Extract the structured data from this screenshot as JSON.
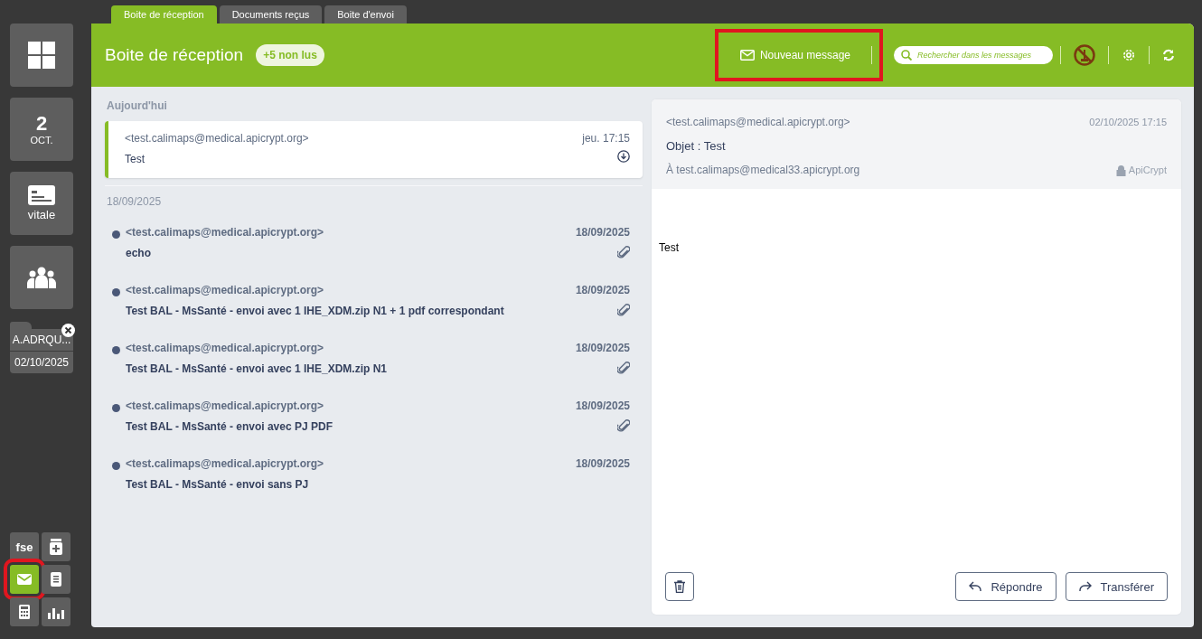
{
  "sidebar": {
    "tiles": [
      {
        "kind": "apps"
      },
      {
        "kind": "date",
        "day": "2",
        "month": "OCT."
      },
      {
        "kind": "card",
        "label": "vitale"
      },
      {
        "kind": "group"
      }
    ],
    "patient_folder": {
      "name": "A.ADRQU...",
      "date": "02/10/2025"
    },
    "shortcuts": [
      {
        "kind": "fse",
        "label": "fse",
        "selected": false,
        "highlighted": false
      },
      {
        "kind": "medicine",
        "selected": false,
        "highlighted": false
      },
      {
        "kind": "mail",
        "selected": true,
        "highlighted": true
      },
      {
        "kind": "document",
        "selected": false,
        "highlighted": false
      },
      {
        "kind": "calculator",
        "selected": false,
        "highlighted": false
      },
      {
        "kind": "chart",
        "selected": false,
        "highlighted": false
      }
    ]
  },
  "tabs": [
    {
      "label": "Boite de réception",
      "selected": true
    },
    {
      "label": "Documents reçus",
      "selected": false
    },
    {
      "label": "Boite d'envoi",
      "selected": false
    }
  ],
  "header": {
    "title": "Boite de réception",
    "unread_badge": "+5 non lus",
    "new_message": {
      "label": "Nouveau message",
      "highlighted": true
    },
    "search": {
      "placeholder": "Rechercher dans les messages"
    }
  },
  "message_groups": [
    {
      "heading": "Aujourd'hui",
      "messages": [
        {
          "sender": "<test.calimaps@medical.apicrypt.org>",
          "subject": "Test",
          "time": "jeu. 17:15",
          "unread": false,
          "selected": true,
          "attachment": false,
          "downloadable": true
        }
      ]
    },
    {
      "heading": "18/09/2025",
      "messages": [
        {
          "sender": "<test.calimaps@medical.apicrypt.org>",
          "subject": "echo",
          "time": "18/09/2025",
          "unread": true,
          "selected": false,
          "attachment": true,
          "downloadable": false
        },
        {
          "sender": "<test.calimaps@medical.apicrypt.org>",
          "subject": "Test BAL - MsSanté - envoi avec 1 IHE_XDM.zip N1 + 1 pdf correspondant",
          "time": "18/09/2025",
          "unread": true,
          "selected": false,
          "attachment": true,
          "downloadable": false
        },
        {
          "sender": "<test.calimaps@medical.apicrypt.org>",
          "subject": "Test BAL - MsSanté - envoi avec 1 IHE_XDM.zip N1",
          "time": "18/09/2025",
          "unread": true,
          "selected": false,
          "attachment": true,
          "downloadable": false
        },
        {
          "sender": "<test.calimaps@medical.apicrypt.org>",
          "subject": "Test BAL - MsSanté - envoi avec PJ PDF",
          "time": "18/09/2025",
          "unread": true,
          "selected": false,
          "attachment": true,
          "downloadable": false
        },
        {
          "sender": "<test.calimaps@medical.apicrypt.org>",
          "subject": "Test BAL - MsSanté - envoi sans PJ",
          "time": "18/09/2025",
          "unread": true,
          "selected": false,
          "attachment": false,
          "downloadable": false
        }
      ]
    }
  ],
  "reader": {
    "sender": "<test.calimaps@medical.apicrypt.org>",
    "date": "02/10/2025 17:15",
    "subject": "Objet : Test",
    "recipient": "À test.calimaps@medical33.apicrypt.org",
    "security_badge": "ApiCrypt",
    "body": "Test",
    "reply_button": "Répondre",
    "forward_button": "Transférer"
  }
}
